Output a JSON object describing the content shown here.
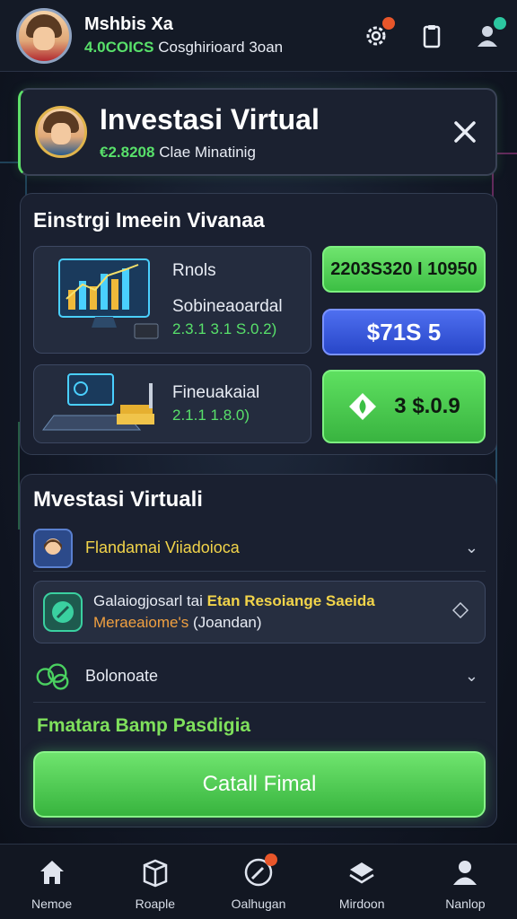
{
  "user": {
    "name": "Mshbis Xa",
    "balance": "4.0COICS",
    "subtitle": "Cosghirioard 3oan"
  },
  "header": {
    "title": "Investasi Virtual",
    "amount": "€2.8208",
    "subtitle": "Clae Minatinig"
  },
  "panel1": {
    "title": "Einstrgi Imeein Vivanaa",
    "row1": {
      "label": "Rnols",
      "sub_label": "Sobineaoardal",
      "value": "2.3.1 3.1 S.0.2)"
    },
    "row2": {
      "label": "Fineuakaial",
      "value": "2.1.1 1.8.0)"
    },
    "action1": "2203S320 I 10950",
    "action2": "$71S 5",
    "action3": "3 $.0.9"
  },
  "panel2": {
    "title": "Mvestasi Virtuali",
    "item1_label": "Flandamai Viiadoioca",
    "item2_line1_a": "Galaiogjosarl tai",
    "item2_line1_b": "Etan Resoiange Saeida",
    "item2_line2_a": "Meraeaiome's",
    "item2_line2_b": "(Joandan)",
    "item3_label": "Bolonoate",
    "footer": "Fmatara Bamp Pasdigia",
    "button": "Catall Fimal"
  },
  "nav": {
    "items": [
      {
        "label": "Nemoe",
        "icon": "home-icon"
      },
      {
        "label": "Roaple",
        "icon": "box-icon"
      },
      {
        "label": "Oalhugan",
        "icon": "compass-icon"
      },
      {
        "label": "Mirdoon",
        "icon": "stack-icon"
      },
      {
        "label": "Nanlop",
        "icon": "user-icon"
      }
    ]
  },
  "colors": {
    "accent_green": "#58e06a",
    "accent_blue": "#3b5de0",
    "accent_yellow": "#f2d44a",
    "background": "#121826"
  }
}
